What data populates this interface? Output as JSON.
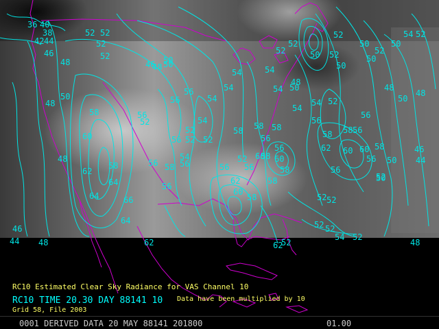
{
  "display": {
    "caption_product": "RC10   Estimated Clear Sky Radiance for VAS Channel 10",
    "caption_time": "RC10 TIME 20.30 DAY 88141 10",
    "caption_note": "Data have been multiplied by 10",
    "caption_grid": "Grid 58,  File 2003",
    "status_frame": "0001 DERIVED DATA 20 MAY 88141 201800",
    "status_index": "01.00"
  },
  "colors": {
    "contour": "#00e5e5",
    "map": "#d000d0",
    "caption": "#ffff66",
    "caption_time": "#00ffff",
    "status": "#cccccc"
  },
  "contour_labels": [
    "36",
    "38",
    "40",
    "42",
    "44",
    "46",
    "48",
    "50",
    "52",
    "54",
    "56",
    "58",
    "60",
    "62",
    "64",
    "65",
    "66"
  ]
}
